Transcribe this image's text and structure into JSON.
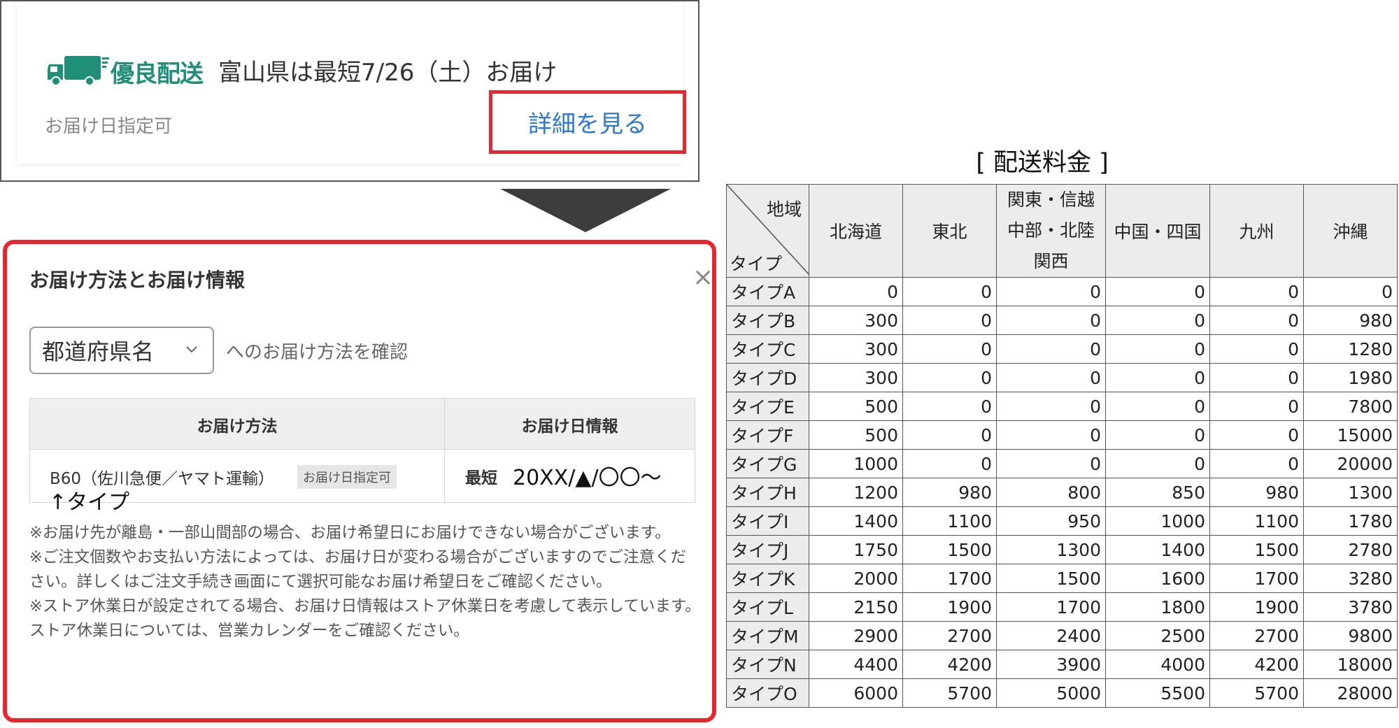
{
  "shipping_card": {
    "badge": "優良配送",
    "delivery_text": "富山県は最短7/26（土）お届け",
    "date_specifiable": "お届け日指定可",
    "details_link": "詳細を見る",
    "truck_icon": "truck-icon"
  },
  "modal": {
    "title": "お届け方法とお届け情報",
    "close_icon": "close-icon",
    "prefecture_select": "都道府県名",
    "prefecture_suffix": "へのお届け方法を確認",
    "table": {
      "header_method": "お届け方法",
      "header_date": "お届け日情報",
      "method": "B60（佐川急便／ヤマト運輸）",
      "method_tag": "お届け日指定可",
      "earliest_label": "最短",
      "earliest_value": "20ⅩⅩ/▲/〇〇～"
    },
    "type_note": "↑タイプ",
    "notes": [
      "※お届け先が離島・一部山間部の場合、お届け希望日にお届けできない場合がございます。",
      "※ご注文個数やお支払い方法によっては、お届け日が変わる場合がございますのでご注意ください。詳しくはご注文手続き画面にて選択可能なお届け希望日をご確認ください。",
      "※ストア休業日が設定されてる場合、お届け日情報はストア休業日を考慮して表示しています。ストア休業日については、営業カレンダーをご確認ください。"
    ]
  },
  "fee_table": {
    "title": "[ 配送料金 ]",
    "corner_region": "地域",
    "corner_type": "タイプ",
    "regions": [
      "北海道",
      "東北",
      "関東・信越|中部・北陸|関西",
      "中国・四国",
      "九州",
      "沖縄"
    ],
    "rows": [
      {
        "type": "タイプA",
        "values": [
          "0",
          "0",
          "0",
          "0",
          "0",
          "0"
        ]
      },
      {
        "type": "タイプB",
        "values": [
          "300",
          "0",
          "0",
          "0",
          "0",
          "980"
        ]
      },
      {
        "type": "タイプC",
        "values": [
          "300",
          "0",
          "0",
          "0",
          "0",
          "1280"
        ]
      },
      {
        "type": "タイプD",
        "values": [
          "300",
          "0",
          "0",
          "0",
          "0",
          "1980"
        ]
      },
      {
        "type": "タイプE",
        "values": [
          "500",
          "0",
          "0",
          "0",
          "0",
          "7800"
        ]
      },
      {
        "type": "タイプF",
        "values": [
          "500",
          "0",
          "0",
          "0",
          "0",
          "15000"
        ]
      },
      {
        "type": "タイプG",
        "values": [
          "1000",
          "0",
          "0",
          "0",
          "0",
          "20000"
        ]
      },
      {
        "type": "タイプH",
        "values": [
          "1200",
          "980",
          "800",
          "850",
          "980",
          "1300"
        ]
      },
      {
        "type": "タイプI",
        "values": [
          "1400",
          "1100",
          "950",
          "1000",
          "1100",
          "1780"
        ]
      },
      {
        "type": "タイプJ",
        "values": [
          "1750",
          "1500",
          "1300",
          "1400",
          "1500",
          "2780"
        ]
      },
      {
        "type": "タイプK",
        "values": [
          "2000",
          "1700",
          "1500",
          "1600",
          "1700",
          "3280"
        ]
      },
      {
        "type": "タイプL",
        "values": [
          "2150",
          "1900",
          "1700",
          "1800",
          "1900",
          "3780"
        ]
      },
      {
        "type": "タイプM",
        "values": [
          "2900",
          "2700",
          "2400",
          "2500",
          "2700",
          "9800"
        ]
      },
      {
        "type": "タイプN",
        "values": [
          "4400",
          "4200",
          "3900",
          "4000",
          "4200",
          "18000"
        ]
      },
      {
        "type": "タイプO",
        "values": [
          "6000",
          "5700",
          "5000",
          "5500",
          "5700",
          "28000"
        ]
      }
    ]
  },
  "colors": {
    "accent_red": "#e8262c",
    "link_blue": "#2a78d4",
    "badge_green": "#1f8f7a"
  }
}
